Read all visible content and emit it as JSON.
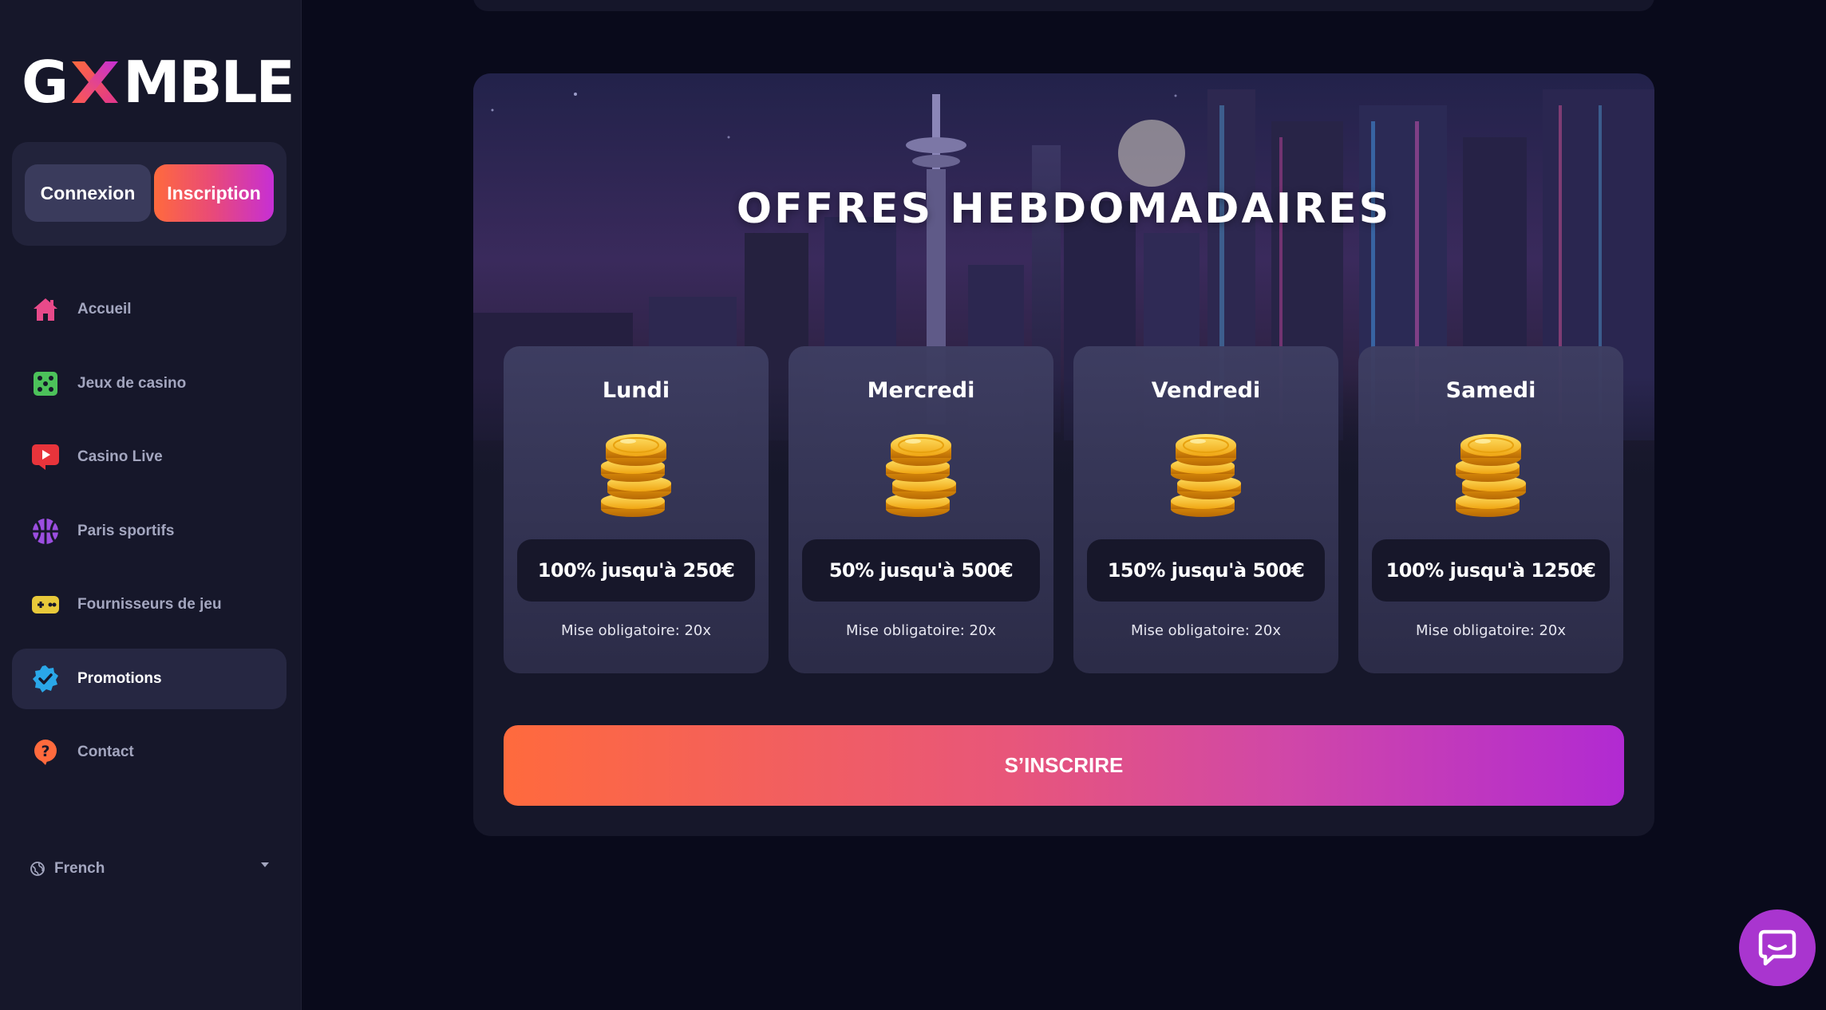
{
  "brand": {
    "logo_left": "G",
    "logo_right": "MBLE",
    "accent_orange": "#ff6a3d",
    "accent_purple": "#b12ad2"
  },
  "auth": {
    "login_label": "Connexion",
    "signup_label": "Inscription"
  },
  "sidebar": {
    "items": [
      {
        "label": "Accueil",
        "icon": "home-icon",
        "color": "#e84a8a"
      },
      {
        "label": "Jeux de casino",
        "icon": "dice-icon",
        "color": "#4cc25a"
      },
      {
        "label": "Casino Live",
        "icon": "play-icon",
        "color": "#e8343b"
      },
      {
        "label": "Paris sportifs",
        "icon": "basketball-icon",
        "color": "#9b4ee0"
      },
      {
        "label": "Fournisseurs de jeu",
        "icon": "gamepad-icon",
        "color": "#e8c93a"
      },
      {
        "label": "Promotions",
        "icon": "badge-check-icon",
        "color": "#2aa7e8",
        "active": true
      },
      {
        "label": "Contact",
        "icon": "help-icon",
        "color": "#ff6a3d"
      }
    ],
    "language": {
      "label": "French",
      "icon": "globe-icon"
    }
  },
  "promo": {
    "title": "OFFRES HEBDOMADAIRES",
    "offers": [
      {
        "day": "Lundi",
        "amount": "100% jusqu'à 250€",
        "wager": "Mise obligatoire: 20x"
      },
      {
        "day": "Mercredi",
        "amount": "50% jusqu'à 500€",
        "wager": "Mise obligatoire: 20x"
      },
      {
        "day": "Vendredi",
        "amount": "150% jusqu'à 500€",
        "wager": "Mise obligatoire: 20x"
      },
      {
        "day": "Samedi",
        "amount": "100% jusqu'à 1250€",
        "wager": "Mise obligatoire: 20x"
      }
    ],
    "cta_label": "S’INSCRIRE"
  },
  "chat": {
    "icon": "chat-icon"
  }
}
